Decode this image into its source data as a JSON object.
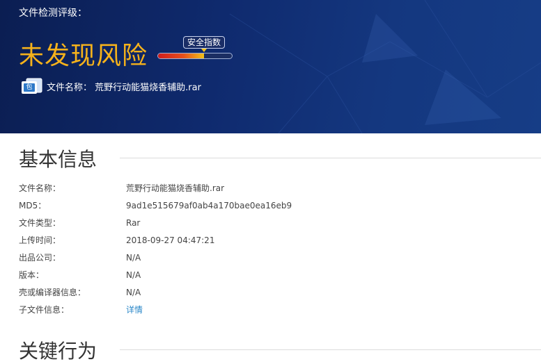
{
  "hero": {
    "title": "文件检测评级：",
    "verdict": "未发现风险",
    "score_label": "安全指数",
    "score_level": 0.62,
    "file_icon_glyph": "包",
    "file_label": "文件名称：  荒野行动能猫烧香辅助.rar"
  },
  "basic": {
    "title": "基本信息",
    "rows": [
      {
        "key": "文件名称：",
        "value": "荒野行动能猫烧香辅助.rar"
      },
      {
        "key": "MD5：",
        "value": "9ad1e515679af0ab4a170bae0ea16eb9"
      },
      {
        "key": "文件类型：",
        "value": "Rar"
      },
      {
        "key": "上传时间：",
        "value": "2018-09-27 04:47:21"
      },
      {
        "key": "出品公司：",
        "value": "N/A"
      },
      {
        "key": "版本：",
        "value": "N/A"
      },
      {
        "key": "壳或编译器信息：",
        "value": "N/A"
      },
      {
        "key": "子文件信息：",
        "value": "详情",
        "link": true
      }
    ]
  },
  "behavior": {
    "title": "关键行为"
  },
  "colors": {
    "verdict": "#f6b21b",
    "link": "#2a87c8",
    "hero_bg": "#0f2a6e"
  }
}
